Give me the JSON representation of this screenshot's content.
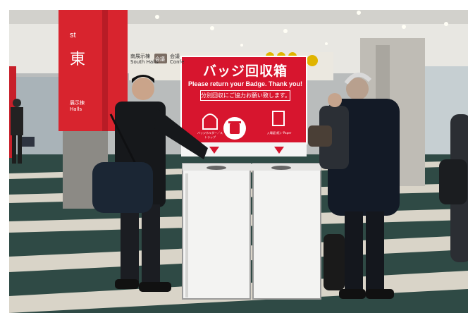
{
  "photo": {
    "subject": "",
    "sign": {
      "title": "バッジ回収箱",
      "english": "Please return your Badge. Thank you!",
      "japanese": "分別回収にご協力お願い致します。",
      "left_caption": "バッジホルダー／ストラップ",
      "right_caption": "入場証(紙)／Paper",
      "color": "#d7152e"
    },
    "pillar": {
      "small_text": "st",
      "big_text": "東",
      "sub_text": "展示棟\nHalls",
      "color": "#d8242e"
    },
    "banner": {
      "left_text": "南展示棟\nSouth Halls",
      "mid_text": "会議\nConfe",
      "badge_text": "会議"
    }
  }
}
